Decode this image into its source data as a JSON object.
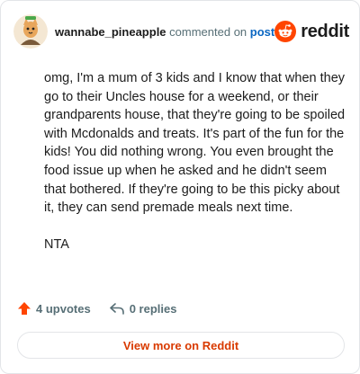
{
  "header": {
    "username": "wannabe_pineapple",
    "commented_text": "commented on",
    "post_link": "post",
    "brand": "reddit"
  },
  "comment": {
    "paragraphs": [
      "omg, I'm a mum of 3 kids and I know that when they go to their Uncles house for a weekend, or their grandparents house, that they're going to be spoiled with Mcdonalds and treats. It's part of the fun for the kids! You did nothing wrong. You even brought the food issue up when he asked and he didn't seem that bothered. If they're going to be this picky about it, they can send premade meals next time.",
      "NTA"
    ]
  },
  "footer": {
    "upvotes": "4 upvotes",
    "replies": "0 replies"
  },
  "cta": {
    "label": "View more on Reddit"
  },
  "colors": {
    "brand_orange": "#ff4500",
    "upvote": "#ff4500",
    "link_blue": "#0a66c2",
    "cta_text": "#d93a00",
    "muted": "#576f76"
  }
}
